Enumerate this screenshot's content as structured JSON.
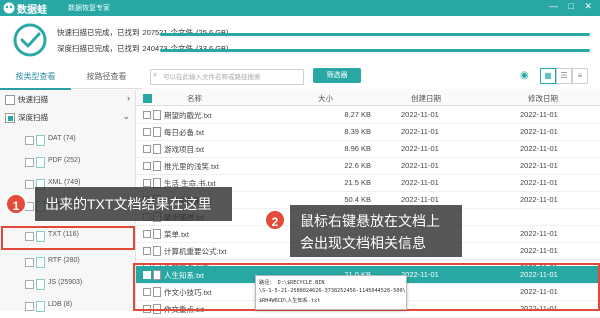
{
  "app": {
    "name": "数据蛙",
    "subtitle": "数据恢复专家",
    "controls": "— □ ✕"
  },
  "status": {
    "quick": [
      "快速扫描已完成，已找到",
      "207521",
      "个文件",
      "(25.6 GB)"
    ],
    "deep": [
      "深度扫描已完成，已找到",
      "240473",
      "个文件",
      "(33.6 GB)"
    ]
  },
  "tabs": {
    "by_type": "按类型查看",
    "by_path": "按路径查看"
  },
  "search": {
    "placeholder": "可以在此输入文件名称或路径搜索",
    "filter": "筛选器"
  },
  "tree": {
    "quick": "快速扫描",
    "deep": "深度扫描",
    "items": [
      {
        "label": "DAT (74)"
      },
      {
        "label": "PDF (252)"
      },
      {
        "label": "XML (749)"
      },
      {
        "label": "HTML (419)"
      },
      {
        "label": "TXT (116)"
      },
      {
        "label": "RTF (280)"
      },
      {
        "label": "JS (25903)"
      },
      {
        "label": "LDB (8)"
      }
    ]
  },
  "table": {
    "headers": {
      "name": "名称",
      "size": "大小",
      "created": "创建日期",
      "modified": "修改日期"
    },
    "rows": [
      {
        "name": "期望的戳光.txt",
        "size": "8.27 KB",
        "created": "2022-11-01",
        "modified": "2022-11-01"
      },
      {
        "name": "每日必备.txt",
        "size": "8.39 KB",
        "created": "2022-11-01",
        "modified": "2022-11-01"
      },
      {
        "name": "游戏项目.txt",
        "size": "8.96 KB",
        "created": "2022-11-01",
        "modified": "2022-11-01"
      },
      {
        "name": "推光里的浅笑.txt",
        "size": "22.6 KB",
        "created": "2022-11-01",
        "modified": "2022-11-01"
      },
      {
        "name": "生活.生命.书.txt",
        "size": "21.5 KB",
        "created": "2022-11-01",
        "modified": "2022-11-01"
      },
      {
        "name": "生活中的美.txt",
        "size": "50.4 KB",
        "created": "2022-11-01",
        "modified": "2022-11-01"
      },
      {
        "name": "散步随想.txt",
        "size": "",
        "created": "",
        "modified": ""
      },
      {
        "name": "菜单.txt",
        "size": "",
        "created": "",
        "modified": "2022-11-01"
      },
      {
        "name": "计算机重要公式.txt",
        "size": "",
        "created": "",
        "modified": "2022-11-01"
      },
      {
        "name": "近期事务必需.txt",
        "size": "",
        "created": "",
        "modified": "2022-11-01"
      },
      {
        "name": "人生知系.txt",
        "size": "21.0 KB",
        "created": "2022-11-01",
        "modified": "2022-11-01"
      },
      {
        "name": "作文小技巧.txt",
        "size": "",
        "created": "",
        "modified": "2022-11-01"
      },
      {
        "name": "作文重点.txt",
        "size": "",
        "created": "",
        "modified": "2022-11-01"
      }
    ]
  },
  "tooltip": {
    "line1": "路径： D:\\$RECYCLE.BIN",
    "line2": "\\S-1-5-21-2588024626-3738252456-1145044528-500\\",
    "line3": "$RH4W6CD\\人生知系.txt"
  },
  "callouts": {
    "one": {
      "num": "1",
      "text": "出来的TXT文档结果在这里"
    },
    "two": {
      "num": "2",
      "line1": "鼠标右键悬放在文档上",
      "line2": "会出现文档相关信息"
    }
  }
}
